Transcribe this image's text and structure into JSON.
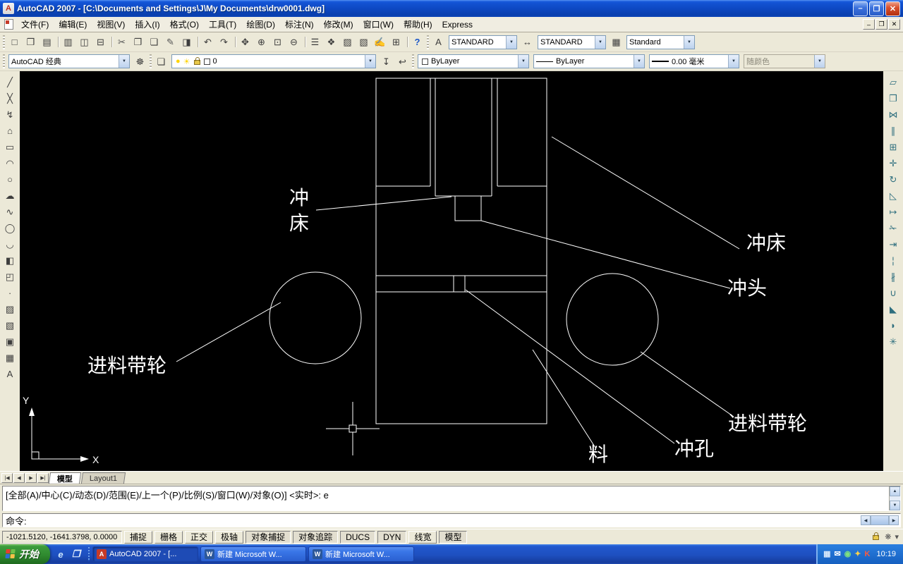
{
  "window": {
    "title": "AutoCAD 2007 - [C:\\Documents and Settings\\J\\My Documents\\drw0001.dwg]",
    "controls": {
      "minimize": "–",
      "restore": "❐",
      "close": "✕"
    }
  },
  "menu_bar": {
    "items": [
      "文件(F)",
      "编辑(E)",
      "视图(V)",
      "插入(I)",
      "格式(O)",
      "工具(T)",
      "绘图(D)",
      "标注(N)",
      "修改(M)",
      "窗口(W)",
      "帮助(H)",
      "Express"
    ]
  },
  "icons": {
    "dropdown_arrow": "▼",
    "scroll_up": "▲",
    "scroll_down": "▼",
    "scroll_left": "◀",
    "scroll_right": "▶",
    "text_style": "A",
    "dim_style": "↔",
    "table_style": "▦",
    "workspace_settings": "☸",
    "layer_manager": "❏",
    "make_layer_current": "↧",
    "layer_previous": "↩",
    "layer_on": "●",
    "layer_freeze": "☀",
    "comm_center": "❋",
    "status_tray_arrow": "▾"
  },
  "standard_toolbar": {
    "icons": [
      {
        "name": "qnew-icon",
        "glyph": "□"
      },
      {
        "name": "open-icon",
        "glyph": "❒"
      },
      {
        "name": "save-icon",
        "glyph": "▤"
      },
      {
        "name": "separator",
        "glyph": ""
      },
      {
        "name": "plot-icon",
        "glyph": "▥"
      },
      {
        "name": "plot-preview-icon",
        "glyph": "◫"
      },
      {
        "name": "publish-icon",
        "glyph": "⊟"
      },
      {
        "name": "separator",
        "glyph": ""
      },
      {
        "name": "cut-icon",
        "glyph": "✂"
      },
      {
        "name": "copy-icon",
        "glyph": "❐"
      },
      {
        "name": "paste-icon",
        "glyph": "❏"
      },
      {
        "name": "match-properties-icon",
        "glyph": "✎"
      },
      {
        "name": "block-editor-icon",
        "glyph": "◨"
      },
      {
        "name": "separator",
        "glyph": ""
      },
      {
        "name": "undo-icon",
        "glyph": "↶"
      },
      {
        "name": "redo-icon",
        "glyph": "↷"
      },
      {
        "name": "separator",
        "glyph": ""
      },
      {
        "name": "pan-icon",
        "glyph": "✥"
      },
      {
        "name": "zoom-realtime-icon",
        "glyph": "⊕"
      },
      {
        "name": "zoom-window-icon",
        "glyph": "⊡"
      },
      {
        "name": "zoom-previous-icon",
        "glyph": "⊖"
      },
      {
        "name": "separator",
        "glyph": ""
      },
      {
        "name": "properties-icon",
        "glyph": "☰"
      },
      {
        "name": "designcenter-icon",
        "glyph": "❖"
      },
      {
        "name": "tool-palettes-icon",
        "glyph": "▨"
      },
      {
        "name": "sheet-set-manager-icon",
        "glyph": "▧"
      },
      {
        "name": "markup-set-manager-icon",
        "glyph": "✍"
      },
      {
        "name": "quickcalc-icon",
        "glyph": "⊞"
      },
      {
        "name": "separator",
        "glyph": ""
      },
      {
        "name": "help-icon",
        "glyph": "?"
      }
    ]
  },
  "styles_toolbar": {
    "text_style": "STANDARD",
    "dim_style": "STANDARD",
    "table_style": "Standard"
  },
  "workspace_toolbar": {
    "workspace": "AutoCAD 经典"
  },
  "layers_toolbar": {
    "current_layer": "0"
  },
  "properties_toolbar": {
    "color": "ByLayer",
    "linetype": "ByLayer",
    "lineweight": "0.00 毫米",
    "plot_style": "随颜色"
  },
  "draw_toolbar": {
    "icons": [
      {
        "name": "line-icon",
        "glyph": "╱"
      },
      {
        "name": "construction-line-icon",
        "glyph": "╳"
      },
      {
        "name": "polyline-icon",
        "glyph": "↯"
      },
      {
        "name": "polygon-icon",
        "glyph": "⌂"
      },
      {
        "name": "rectangle-icon",
        "glyph": "▭"
      },
      {
        "name": "arc-icon",
        "glyph": "◠"
      },
      {
        "name": "circle-icon",
        "glyph": "○"
      },
      {
        "name": "revcloud-icon",
        "glyph": "☁"
      },
      {
        "name": "spline-icon",
        "glyph": "∿"
      },
      {
        "name": "ellipse-icon",
        "glyph": "◯"
      },
      {
        "name": "ellipse-arc-icon",
        "glyph": "◡"
      },
      {
        "name": "insert-block-icon",
        "glyph": "◧"
      },
      {
        "name": "make-block-icon",
        "glyph": "◰"
      },
      {
        "name": "point-icon",
        "glyph": "∙"
      },
      {
        "name": "hatch-icon",
        "glyph": "▨"
      },
      {
        "name": "gradient-icon",
        "glyph": "▧"
      },
      {
        "name": "region-icon",
        "glyph": "▣"
      },
      {
        "name": "table-icon",
        "glyph": "▦"
      },
      {
        "name": "mtext-icon",
        "glyph": "A"
      }
    ]
  },
  "modify_toolbar": {
    "icons": [
      {
        "name": "erase-icon",
        "glyph": "▱"
      },
      {
        "name": "copy-object-icon",
        "glyph": "❐"
      },
      {
        "name": "mirror-icon",
        "glyph": "⋈"
      },
      {
        "name": "offset-icon",
        "glyph": "∥"
      },
      {
        "name": "array-icon",
        "glyph": "⊞"
      },
      {
        "name": "move-icon",
        "glyph": "✛"
      },
      {
        "name": "rotate-icon",
        "glyph": "↻"
      },
      {
        "name": "scale-icon",
        "glyph": "◺"
      },
      {
        "name": "stretch-icon",
        "glyph": "↦"
      },
      {
        "name": "trim-icon",
        "glyph": "✁"
      },
      {
        "name": "extend-icon",
        "glyph": "⇥"
      },
      {
        "name": "break-at-point-icon",
        "glyph": "¦"
      },
      {
        "name": "break-icon",
        "glyph": "∦"
      },
      {
        "name": "join-icon",
        "glyph": "∪"
      },
      {
        "name": "chamfer-icon",
        "glyph": "◣"
      },
      {
        "name": "fillet-icon",
        "glyph": "◗"
      },
      {
        "name": "explode-icon",
        "glyph": "✳"
      }
    ]
  },
  "drawing": {
    "labels": {
      "press_left_1": "冲",
      "press_left_2": "床",
      "press_right": "冲床",
      "punch_head": "冲头",
      "feed_pulley_left": "进料带轮",
      "feed_pulley_right": "进料带轮",
      "material": "料",
      "punch_hole": "冲孔"
    },
    "ucs": {
      "x": "X",
      "y": "Y"
    }
  },
  "layout_tabs": {
    "nav": [
      "|◀",
      "◀",
      "▶",
      "▶|"
    ],
    "tabs": [
      {
        "name": "tab-model",
        "label": "模型",
        "active": true
      },
      {
        "name": "tab-layout1",
        "label": "Layout1",
        "active": false
      }
    ]
  },
  "command_window": {
    "history_line": "[全部(A)/中心(C)/动态(D)/范围(E)/上一个(P)/比例(S)/窗口(W)/对象(O)] <实时>: e",
    "prompt_line": "命令:"
  },
  "status_bar": {
    "coordinates": "-1021.5120, -1641.3798, 0.0000",
    "toggles": [
      {
        "name": "toggle-snap",
        "label": "捕捉",
        "pressed": false
      },
      {
        "name": "toggle-grid",
        "label": "栅格",
        "pressed": false
      },
      {
        "name": "toggle-ortho",
        "label": "正交",
        "pressed": false
      },
      {
        "name": "toggle-polar",
        "label": "极轴",
        "pressed": false
      },
      {
        "name": "toggle-osnap",
        "label": "对象捕捉",
        "pressed": true
      },
      {
        "name": "toggle-otrack",
        "label": "对象追踪",
        "pressed": true
      },
      {
        "name": "toggle-ducs",
        "label": "DUCS",
        "pressed": true
      },
      {
        "name": "toggle-dyn",
        "label": "DYN",
        "pressed": true
      },
      {
        "name": "toggle-lwt",
        "label": "线宽",
        "pressed": false
      },
      {
        "name": "toggle-model",
        "label": "模型",
        "pressed": true
      }
    ]
  },
  "taskbar": {
    "start_label": "开始",
    "quick_launch": [
      {
        "name": "ie-icon",
        "glyph": "e",
        "color": "#cfe8ff"
      },
      {
        "name": "show-desktop-icon",
        "glyph": "❐",
        "color": "#e8f2ff"
      }
    ],
    "tasks": [
      {
        "name": "task-autocad",
        "icon": "A",
        "label": "AutoCAD 2007 - [...",
        "active": true
      },
      {
        "name": "task-word-1",
        "icon": "W",
        "label": "新建 Microsoft W...",
        "active": false
      },
      {
        "name": "task-word-2",
        "icon": "W",
        "label": "新建 Microsoft W...",
        "active": false
      }
    ],
    "tray_icons": [
      {
        "name": "tray-input-icon",
        "glyph": "▦",
        "color": "#d8e8fa"
      },
      {
        "name": "tray-message-icon",
        "glyph": "✉",
        "color": "#ffffff"
      },
      {
        "name": "tray-network-icon",
        "glyph": "◉",
        "color": "#7fe07f"
      },
      {
        "name": "tray-update-icon",
        "glyph": "✦",
        "color": "#ffd24a"
      },
      {
        "name": "tray-k-icon",
        "glyph": "K",
        "color": "#ff5a3c"
      }
    ],
    "time": "10:19"
  }
}
